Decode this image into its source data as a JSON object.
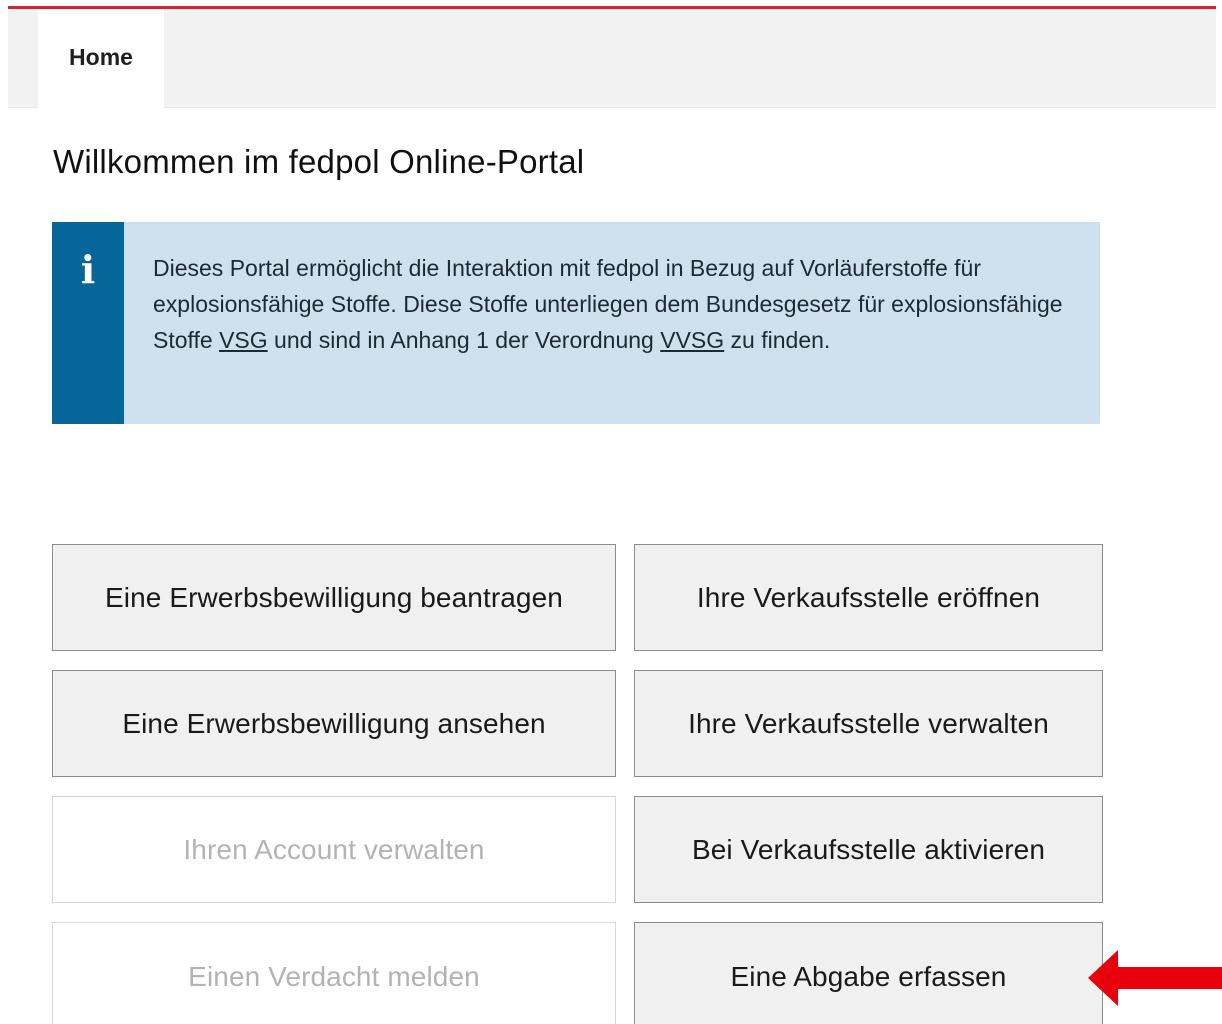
{
  "nav": {
    "tabs": [
      {
        "label": "Home",
        "active": true
      }
    ]
  },
  "page": {
    "title": "Willkommen im fedpol Online-Portal"
  },
  "info": {
    "icon": "info-icon",
    "text_before_vsg": "Dieses Portal ermöglicht die Interaktion mit fedpol in Bezug auf Vorläuferstoffe für explosionsfähige Stoffe. Diese Stoffe unterliegen dem Bundesgesetz für explosionsfähige Stoffe ",
    "link_vsg": "VSG",
    "text_middle": " und sind in Anhang 1 der Verordnung ",
    "link_vvsg": "VVSG",
    "text_after": " zu finden."
  },
  "actions": {
    "request_permit": {
      "label": "Eine Erwerbsbewilligung beantragen",
      "enabled": true
    },
    "open_sales_point": {
      "label": "Ihre Verkaufsstelle eröffnen",
      "enabled": true
    },
    "view_permit": {
      "label": "Eine Erwerbsbewilligung ansehen",
      "enabled": true
    },
    "manage_sales_point": {
      "label": "Ihre Verkaufsstelle verwalten",
      "enabled": true
    },
    "manage_account": {
      "label": "Ihren Account verwalten",
      "enabled": false
    },
    "activate_at_sales_point": {
      "label": "Bei Verkaufsstelle aktivieren",
      "enabled": true
    },
    "report_suspicion": {
      "label": "Einen Verdacht melden",
      "enabled": false
    },
    "record_transaction": {
      "label": "Eine Abgabe erfassen",
      "enabled": true
    }
  },
  "annotation": {
    "icon": "arrow-left-icon",
    "color": "#e8000b"
  },
  "colors": {
    "brand_red": "#d8232a",
    "info_strip": "#06669a",
    "info_background": "#cde0eb"
  }
}
